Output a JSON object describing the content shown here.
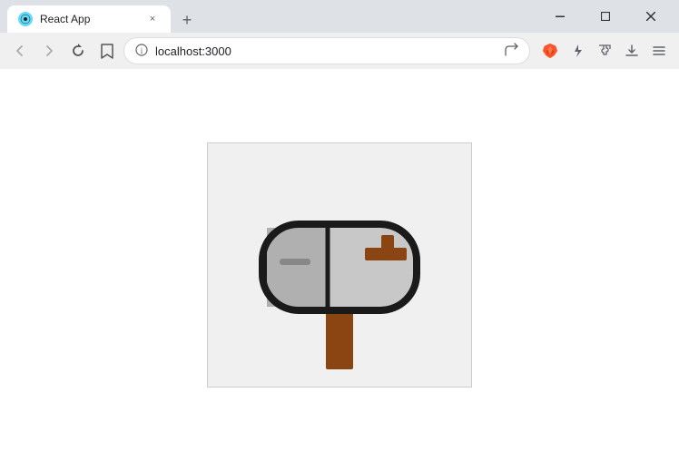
{
  "browser": {
    "tab_title": "React App",
    "tab_close": "×",
    "new_tab": "+",
    "window_controls": {
      "minimize": "—",
      "maximize": "□",
      "close": "✕"
    },
    "nav": {
      "back": "‹",
      "forward": "›",
      "reload": "↻",
      "bookmark": "🔖"
    },
    "address": "localhost:3000",
    "security_icon": "ⓘ"
  },
  "page": {
    "title": "React App"
  }
}
